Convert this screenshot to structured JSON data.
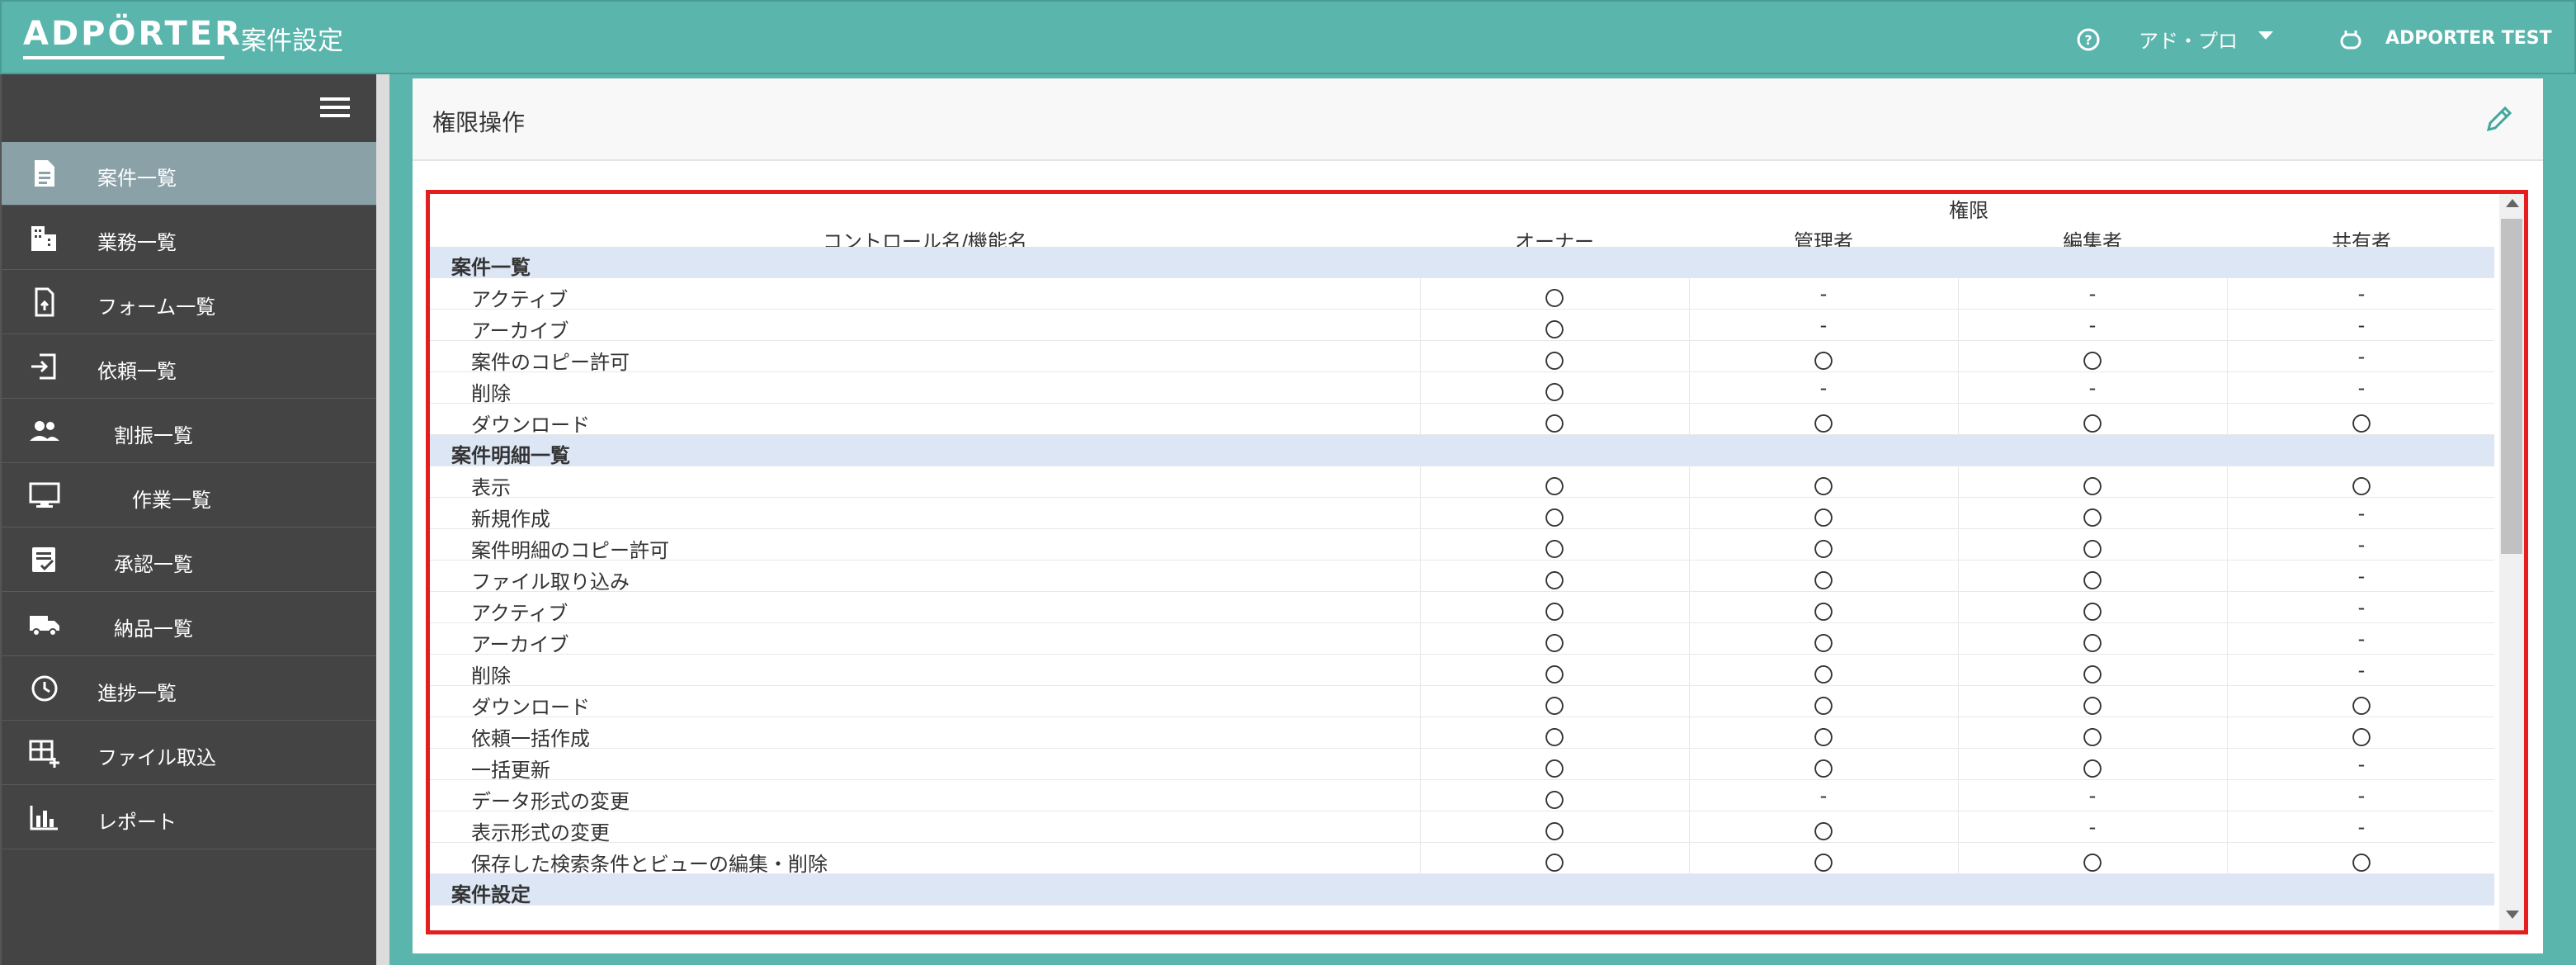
{
  "header": {
    "logo": "ADPÖRTER",
    "app_title": "案件設定",
    "account": "アド・プロ",
    "user": "ADPORTER TEST"
  },
  "sidebar": {
    "items": [
      {
        "label": "案件一覧",
        "icon": "document-icon",
        "active": true
      },
      {
        "label": "業務一覧",
        "icon": "building-icon"
      },
      {
        "label": "フォーム一覧",
        "icon": "form-icon"
      },
      {
        "label": "依頼一覧",
        "icon": "request-icon"
      },
      {
        "label": "割振一覧",
        "icon": "people-icon"
      },
      {
        "label": "作業一覧",
        "icon": "monitor-icon"
      },
      {
        "label": "承認一覧",
        "icon": "approval-icon"
      },
      {
        "label": "納品一覧",
        "icon": "truck-icon"
      },
      {
        "label": "進捗一覧",
        "icon": "clock-icon"
      },
      {
        "label": "ファイル取込",
        "icon": "table-add-icon"
      },
      {
        "label": "レポート",
        "icon": "bar-chart-icon"
      }
    ]
  },
  "panel": {
    "title": "権限操作"
  },
  "table": {
    "group_header": "権限",
    "name_header": "コントロール名/機能名",
    "role_headers": [
      "オーナー",
      "管理者",
      "編集者",
      "共有者"
    ],
    "rows": [
      {
        "type": "section",
        "name": "案件一覧"
      },
      {
        "name": "アクティブ",
        "values": [
          "〇",
          "-",
          "-",
          "-"
        ]
      },
      {
        "name": "アーカイブ",
        "values": [
          "〇",
          "-",
          "-",
          "-"
        ]
      },
      {
        "name": "案件のコピー許可",
        "values": [
          "〇",
          "〇",
          "〇",
          "-"
        ]
      },
      {
        "name": "削除",
        "values": [
          "〇",
          "-",
          "-",
          "-"
        ]
      },
      {
        "name": "ダウンロード",
        "values": [
          "〇",
          "〇",
          "〇",
          "〇"
        ]
      },
      {
        "type": "section",
        "name": "案件明細一覧"
      },
      {
        "name": "表示",
        "values": [
          "〇",
          "〇",
          "〇",
          "〇"
        ]
      },
      {
        "name": "新規作成",
        "values": [
          "〇",
          "〇",
          "〇",
          "-"
        ]
      },
      {
        "name": "案件明細のコピー許可",
        "values": [
          "〇",
          "〇",
          "〇",
          "-"
        ]
      },
      {
        "name": "ファイル取り込み",
        "values": [
          "〇",
          "〇",
          "〇",
          "-"
        ]
      },
      {
        "name": "アクティブ",
        "values": [
          "〇",
          "〇",
          "〇",
          "-"
        ]
      },
      {
        "name": "アーカイブ",
        "values": [
          "〇",
          "〇",
          "〇",
          "-"
        ]
      },
      {
        "name": "削除",
        "values": [
          "〇",
          "〇",
          "〇",
          "-"
        ]
      },
      {
        "name": "ダウンロード",
        "values": [
          "〇",
          "〇",
          "〇",
          "〇"
        ]
      },
      {
        "name": "依頼一括作成",
        "values": [
          "〇",
          "〇",
          "〇",
          "〇"
        ]
      },
      {
        "name": "一括更新",
        "values": [
          "〇",
          "〇",
          "〇",
          "-"
        ]
      },
      {
        "name": "データ形式の変更",
        "values": [
          "〇",
          "-",
          "-",
          "-"
        ]
      },
      {
        "name": "表示形式の変更",
        "values": [
          "〇",
          "〇",
          "-",
          "-"
        ]
      },
      {
        "name": "保存した検索条件とビューの編集・削除",
        "values": [
          "〇",
          "〇",
          "〇",
          "〇"
        ]
      },
      {
        "type": "section",
        "name": "案件設定"
      }
    ]
  }
}
